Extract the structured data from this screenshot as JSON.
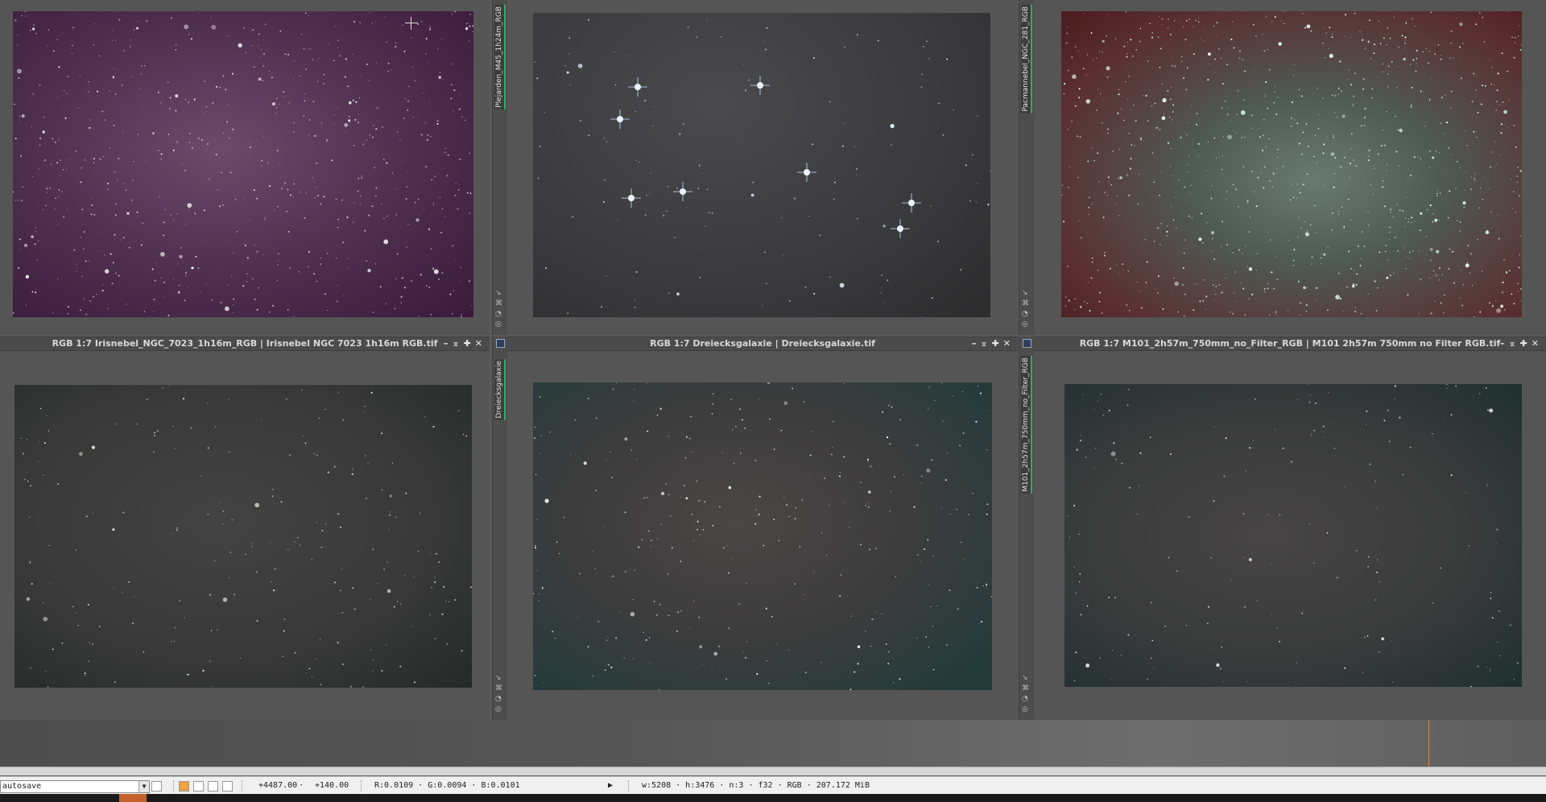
{
  "windows": [
    {
      "id": "w1",
      "title": "",
      "sidetab": "Plejarden_M45_1h24m_RGB"
    },
    {
      "id": "w2",
      "title": "",
      "sidetab": "Pacmannebel_NGC_281_RGB"
    },
    {
      "id": "w3",
      "title": "RGB 1:7 Irisnebel_NGC_7023_1h16m_RGB | Irisnebel NGC 7023 1h16m RGB.tif",
      "sidetab": "Dreiecksgalaxie"
    },
    {
      "id": "w4",
      "title": "RGB 1:7 Dreiecksgalaxie | Dreiecksgalaxie.tif",
      "sidetab": "M101_2h57m_750mm_no_Filter_RGB"
    },
    {
      "id": "w5",
      "title": "RGB 1:7 M101_2h57m_750mm_no_Filter_RGB | M101 2h57m 750mm no Filter RGB.tif"
    }
  ],
  "window_controls": {
    "minimize": "–",
    "shade": "⌅",
    "maximize": "✚",
    "close": "✕"
  },
  "statusbar": {
    "process_select_value": "autosave",
    "coord_x": "+4487.00",
    "coord_y": "+140.00",
    "pixel_values": "R:0.0109 · G:0.0094 · B:0.0101",
    "image_info": "w:5208 · h:3476 · n:3 · f32 · RGB · 207.172 MiB",
    "coord_sep": "·",
    "play_icon": "play-icon"
  },
  "colors": {
    "workspace": "#5a5a5a",
    "titlebar": "#4b4b4b",
    "tab_accent": "#2fae5d",
    "statusbar": "#f0f0f0",
    "preview_orange": "#f0a040"
  }
}
